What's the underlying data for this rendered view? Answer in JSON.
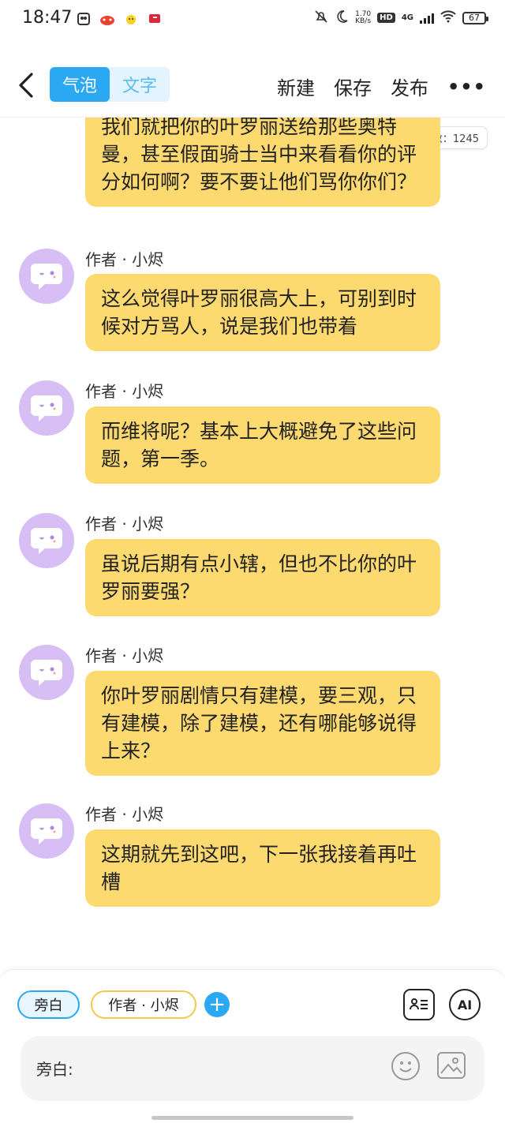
{
  "status_bar": {
    "time": "18:47",
    "net_speed_value": "1.70",
    "net_speed_unit": "KB/s",
    "hd": "HD",
    "network": "4G",
    "battery": "67"
  },
  "header": {
    "tabs": [
      {
        "label": "气泡",
        "active": true
      },
      {
        "label": "文字",
        "active": false
      }
    ],
    "new_label": "新建",
    "save_label": "保存",
    "publish_label": "发布",
    "more_label": "•••"
  },
  "word_count": "字数：1245",
  "messages": [
    {
      "author": "",
      "text": "我们就把你的叶罗丽送给那些奥特曼，甚至假面骑士当中来看看你的评分如何啊？要不要让他们骂你你们？"
    },
    {
      "author": "作者 · 小烬",
      "text": "这么觉得叶罗丽很高大上，可别到时候对方骂人，说是我们也带着"
    },
    {
      "author": "作者 · 小烬",
      "text": "而维将呢？基本上大概避免了这些问题，第一季。"
    },
    {
      "author": "作者 · 小烬",
      "text": "虽说后期有点小辖，但也不比你的叶罗丽要强？"
    },
    {
      "author": "作者 · 小烬",
      "text": "你叶罗丽剧情只有建模，要三观，只有建模，除了建模，还有哪能够说得上来？"
    },
    {
      "author": "作者 · 小烬",
      "text": "这期就先到这吧，下一张我接着再吐槽"
    }
  ],
  "composer": {
    "role_chips": [
      {
        "label": "旁白",
        "selected": true
      },
      {
        "label": "作者 · 小烬",
        "selected": false
      }
    ],
    "add_label": "+",
    "ai_label": "AI",
    "input_label": "旁白:"
  },
  "colors": {
    "accent": "#2aa8f2",
    "bubble": "#fdda6f",
    "avatar": "#d7bff5"
  }
}
